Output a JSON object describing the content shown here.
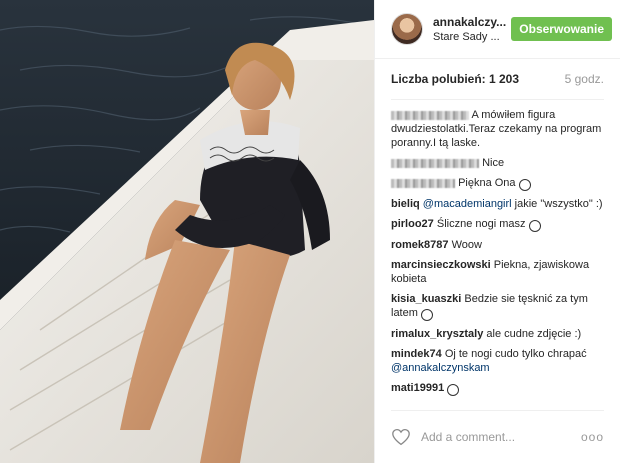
{
  "header": {
    "username": "annakalczy...",
    "location": "Stare Sady ...",
    "follow_label": "Obserwowanie"
  },
  "stats": {
    "likes": "Liczba polubień: 1 203",
    "time_ago": "5 godz."
  },
  "comments": [
    {
      "user": "",
      "text": "A mówiłem figura dwudziestolatki.Teraz czekamy na program poranny.I tą laske."
    },
    {
      "user": "",
      "text": "Nice"
    },
    {
      "user": "",
      "text": "Piękna Ona"
    },
    {
      "user": "bieliq",
      "mention": "@macademiangirl",
      "text": " jakie \"wszystko\" :)"
    },
    {
      "user": "pirloo27",
      "text": "Śliczne nogi masz"
    },
    {
      "user": "romek8787",
      "text": "Woow"
    },
    {
      "user": "marcinsieczkowski",
      "text": "Piekna, zjawiskowa kobieta"
    },
    {
      "user": "kisia_kuaszki",
      "text": "Bedzie sie tęsknić za tym latem"
    },
    {
      "user": "rimalux_krysztaly",
      "text": "ale cudne zdjęcie :)"
    },
    {
      "user": "mindek74",
      "text": "Oj te nogi cudo tylko chrapać",
      "mention": "@annakalczynskam"
    },
    {
      "user": "mati19991",
      "text": ""
    }
  ],
  "footer": {
    "add_comment_placeholder": "Add a comment...",
    "more_label": "ooo"
  },
  "colors": {
    "follow": "#70c050",
    "mention": "#003569"
  },
  "icons": {
    "like": "heart-icon",
    "more": "more-options-icon"
  }
}
